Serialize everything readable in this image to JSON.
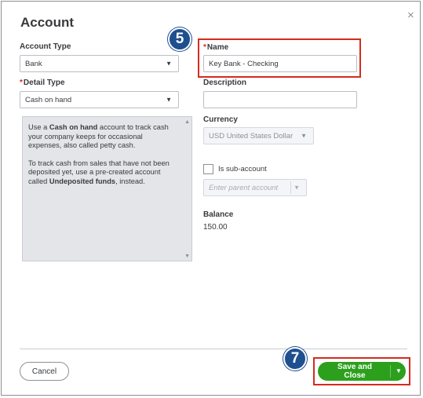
{
  "dialog": {
    "title": "Account",
    "close_glyph": "×"
  },
  "account_type": {
    "label": "Account Type",
    "value": "Bank"
  },
  "detail_type": {
    "required_mark": "*",
    "label": "Detail Type",
    "value": "Cash on hand"
  },
  "help": {
    "p1_pre": "Use a ",
    "p1_bold": "Cash on hand",
    "p1_post": " account to track cash your company keeps for occasional expenses, also called petty cash.",
    "p2_pre": "To track cash from sales that have not been deposited yet, use a pre-created account called ",
    "p2_bold": "Undeposited funds",
    "p2_post": ", instead."
  },
  "name": {
    "required_mark": "*",
    "label": "Name",
    "value": "Key Bank - Checking"
  },
  "description": {
    "label": "Description",
    "value": ""
  },
  "currency": {
    "label": "Currency",
    "value": "USD United States Dollar"
  },
  "sub_account": {
    "label": "Is sub-account",
    "checked": false,
    "placeholder": "Enter parent account"
  },
  "balance": {
    "label": "Balance",
    "value": "150.00"
  },
  "footer": {
    "cancel_label": "Cancel",
    "save_label": "Save and Close"
  },
  "annotations": {
    "step_name": "5",
    "step_save": "7"
  },
  "colors": {
    "primary_green": "#2ca01c",
    "highlight_red": "#d52b1e",
    "badge_blue": "#1e4f8f"
  }
}
